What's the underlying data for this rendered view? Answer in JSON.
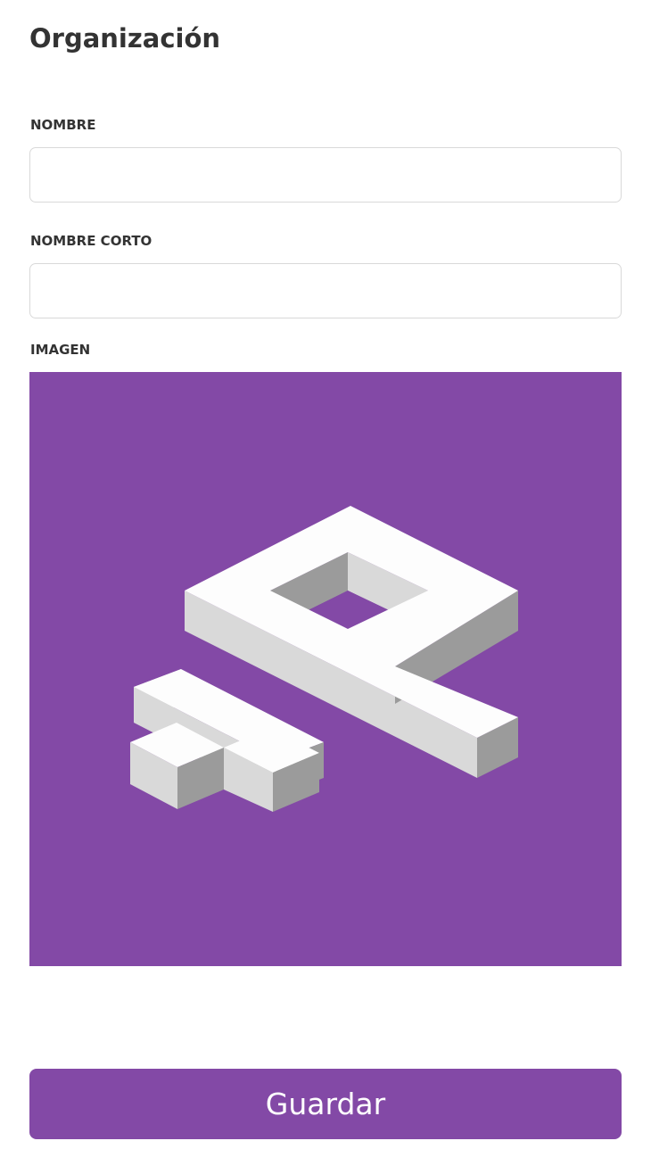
{
  "page": {
    "title": "Organización"
  },
  "form": {
    "name_label": "NOMBRE",
    "name_value": "",
    "short_name_label": "NOMBRE CORTO",
    "short_name_value": "",
    "image_label": "IMAGEN",
    "image_icon": "isometric-venus-symbol-icon",
    "save_label": "Guardar"
  },
  "colors": {
    "accent": "#8349a6",
    "image_background": "#8349a6",
    "shape_top": "#fdfdfd",
    "shape_left": "#d9d9d9",
    "shape_right": "#9b9b9b",
    "text": "#333333",
    "input_border": "#d9d9d9"
  }
}
